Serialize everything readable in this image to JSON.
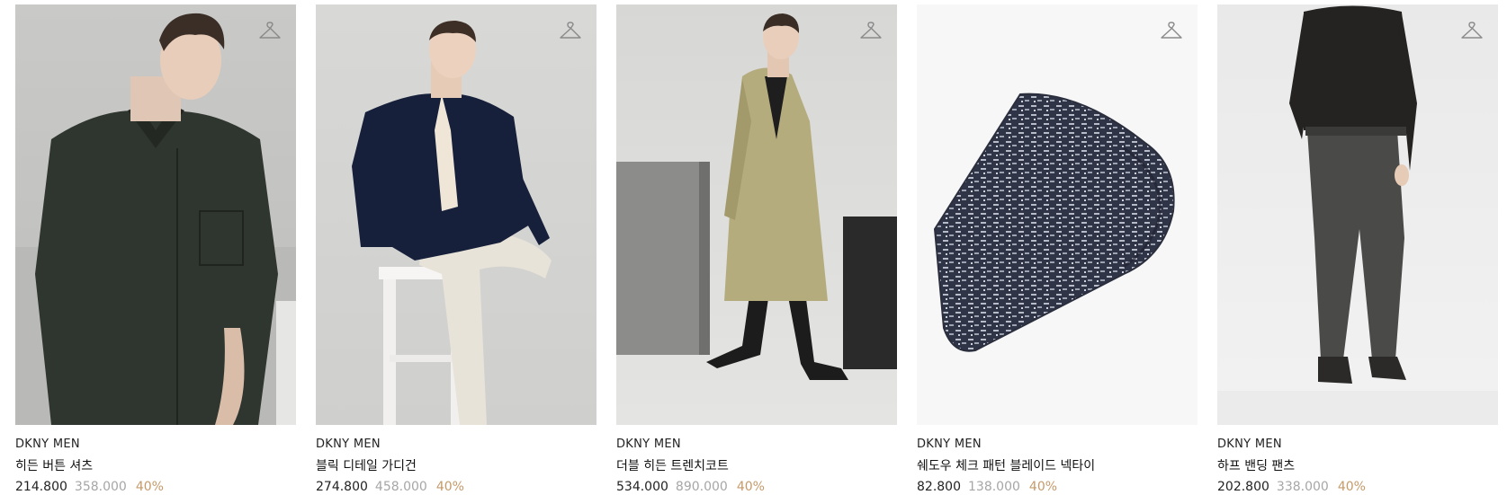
{
  "colors": {
    "discount": "#c59a6a",
    "original_price": "#a6a6a6",
    "sale_price": "#222222"
  },
  "products": [
    {
      "brand": "DKNY MEN",
      "name": "히든 버튼 셔츠",
      "sale_price": "214.800",
      "original_price": "358.000",
      "discount": "40%",
      "icon": "hanger-icon"
    },
    {
      "brand": "DKNY MEN",
      "name": "블릭 디테일 가디건",
      "sale_price": "274.800",
      "original_price": "458.000",
      "discount": "40%",
      "icon": "hanger-icon"
    },
    {
      "brand": "DKNY MEN",
      "name": "더블 히든 트렌치코트",
      "sale_price": "534.000",
      "original_price": "890.000",
      "discount": "40%",
      "icon": "hanger-icon"
    },
    {
      "brand": "DKNY MEN",
      "name": "쉐도우 체크 패턴 블레이드 넥타이",
      "sale_price": "82.800",
      "original_price": "138.000",
      "discount": "40%",
      "icon": "hanger-icon"
    },
    {
      "brand": "DKNY MEN",
      "name": "하프 밴딩 팬츠",
      "sale_price": "202.800",
      "original_price": "338.000",
      "discount": "40%",
      "icon": "hanger-icon"
    }
  ]
}
